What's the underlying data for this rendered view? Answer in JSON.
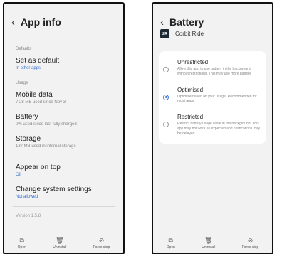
{
  "left": {
    "title": "App info",
    "defaults_label": "Defaults",
    "set_default": {
      "title": "Set as default",
      "sub": "In other apps"
    },
    "usage_label": "Usage",
    "mobile_data": {
      "title": "Mobile data",
      "sub": "7.28 MB used since Nov 3"
    },
    "battery": {
      "title": "Battery",
      "sub": "0% used since last fully charged"
    },
    "storage": {
      "title": "Storage",
      "sub": "137 MB used in internal storage"
    },
    "appear_on_top": {
      "title": "Appear on top",
      "sub": "Off"
    },
    "change_settings": {
      "title": "Change system settings",
      "sub": "Not allowed"
    },
    "version": "Version 1.5.8",
    "bottom": [
      {
        "icon": "open-icon",
        "glyph": "⧉",
        "label": "Open"
      },
      {
        "icon": "trash-icon",
        "glyph": "🗑",
        "label": "Uninstall"
      },
      {
        "icon": "force-stop-icon",
        "glyph": "⊘",
        "label": "Force stop"
      }
    ]
  },
  "right": {
    "title": "Battery",
    "app_icon_text": "ZR",
    "app_name": "Corbit Ride",
    "options": [
      {
        "title": "Unrestricted",
        "desc": "Allow this app to use battery in the background without restrictions. This may use more battery.",
        "selected": false
      },
      {
        "title": "Optimised",
        "desc": "Optimise based on your usage. Recommended for most apps.",
        "selected": true
      },
      {
        "title": "Restricted",
        "desc": "Restrict battery usage while in the background. This app may not work as expected and notifications may be delayed.",
        "selected": false
      }
    ],
    "bottom": [
      {
        "icon": "open-icon",
        "glyph": "⧉",
        "label": "Open"
      },
      {
        "icon": "trash-icon",
        "glyph": "🗑",
        "label": "Uninstall"
      },
      {
        "icon": "force-stop-icon",
        "glyph": "⊘",
        "label": "Force stop"
      }
    ]
  },
  "colors": {
    "accent": "#3b73d1",
    "background": "#f2f2f2",
    "card": "#ffffff"
  }
}
